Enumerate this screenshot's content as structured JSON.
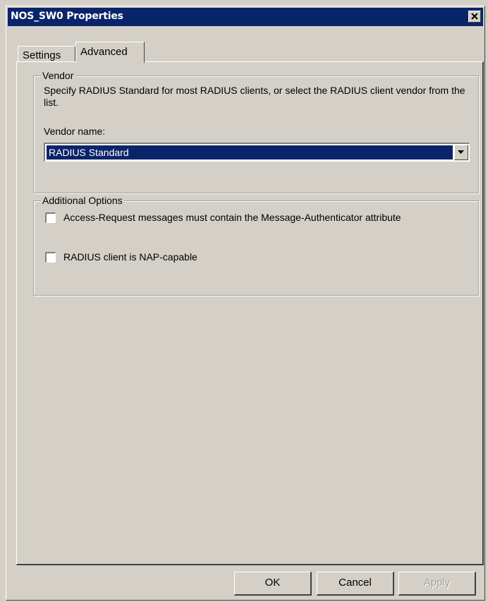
{
  "window": {
    "title": "NOS_SW0 Properties"
  },
  "tabs": [
    {
      "label": "Settings",
      "selected": false
    },
    {
      "label": "Advanced",
      "selected": true
    }
  ],
  "vendor_group": {
    "legend": "Vendor",
    "description": "Specify RADIUS Standard for most RADIUS clients, or select the RADIUS client vendor from the list.",
    "vendor_name_label": "Vendor name:",
    "vendor_name_value": "RADIUS Standard"
  },
  "options_group": {
    "legend": "Additional Options",
    "checkboxes": [
      {
        "label": "Access-Request messages must contain the Message-Authenticator attribute",
        "checked": false
      },
      {
        "label": "RADIUS client is NAP-capable",
        "checked": false
      }
    ]
  },
  "buttons": {
    "ok": "OK",
    "cancel": "Cancel",
    "apply": "Apply",
    "apply_enabled": false
  },
  "colors": {
    "dialog_bg": "#d4d0c8",
    "titlebar": "#0a246a",
    "selection": "#0a246a"
  },
  "icons": {
    "close": "close-icon",
    "dropdown": "chevron-down-icon"
  }
}
